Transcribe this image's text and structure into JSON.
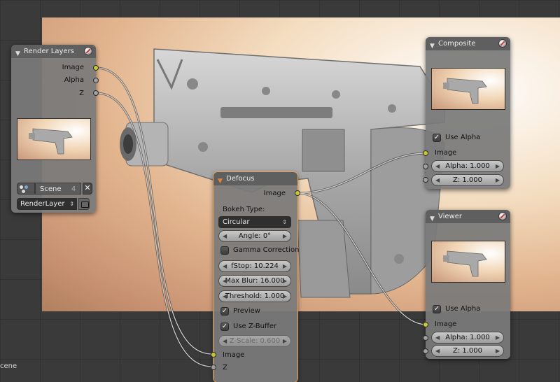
{
  "nodes": {
    "render_layers": {
      "title": "Render Layers",
      "outputs": [
        "Image",
        "Alpha",
        "Z"
      ],
      "scene": {
        "name": "Scene",
        "count": "4",
        "clear_glyph": "✕"
      },
      "layer": "RenderLayer"
    },
    "defocus": {
      "title": "Defocus",
      "output": "Image",
      "bokeh_label": "Bokeh Type:",
      "bokeh_value": "Circular",
      "angle": "Angle: 0°",
      "gamma_correction": {
        "label": "Gamma Correction",
        "checked": false
      },
      "fstop": "fStop: 10.224",
      "max_blur": "Max Blur: 16.000",
      "threshold": "Threshold: 1.000",
      "preview": {
        "label": "Preview",
        "checked": true
      },
      "use_zbuffer": {
        "label": "Use Z-Buffer",
        "checked": true
      },
      "z_scale": "Z-Scale: 0.600",
      "inputs": [
        "Image",
        "Z"
      ]
    },
    "composite": {
      "title": "Composite",
      "use_alpha": {
        "label": "Use Alpha",
        "checked": true
      },
      "input_image": "Image",
      "alpha": "Alpha: 1.000",
      "z": "Z: 1.000"
    },
    "viewer": {
      "title": "Viewer",
      "use_alpha": {
        "label": "Use Alpha",
        "checked": true
      },
      "input_image": "Image",
      "alpha": "Alpha: 1.000",
      "z": "Z: 1.000"
    }
  },
  "footer": {
    "label": "cene"
  },
  "colors": {
    "image_socket": "#c8c838",
    "value_socket": "#a0a0a0",
    "node_body": "#7a7a7a",
    "node_header": "#5f5f5f",
    "active_outline": "#e8a65a",
    "grid_bg": "#3a3a3a"
  },
  "glyphs": {
    "collapse": "▼",
    "arrow_left": "◀",
    "arrow_right": "▶",
    "dropdown": "⇕",
    "check": "✓"
  }
}
